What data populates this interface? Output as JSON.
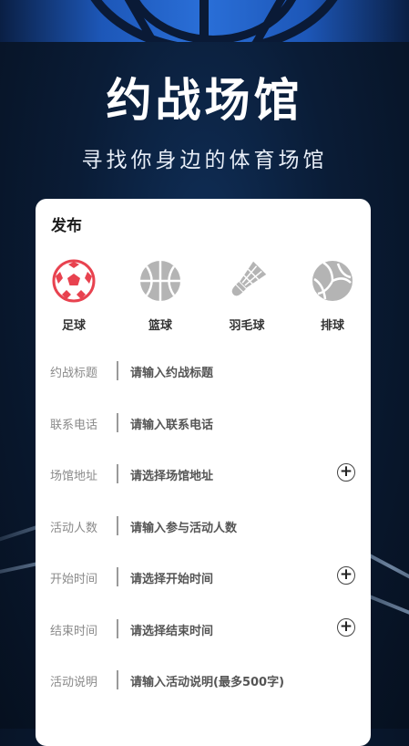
{
  "header": {
    "title": "约战场馆",
    "subtitle": "寻找你身边的体育场馆"
  },
  "card": {
    "title": "发布",
    "sports": [
      {
        "label": "足球",
        "icon": "soccer-ball-icon",
        "selected": true
      },
      {
        "label": "篮球",
        "icon": "basketball-icon",
        "selected": false
      },
      {
        "label": "羽毛球",
        "icon": "shuttlecock-icon",
        "selected": false
      },
      {
        "label": "排球",
        "icon": "volleyball-icon",
        "selected": false
      }
    ],
    "fields": [
      {
        "label": "约战标题",
        "placeholder": "请输入约战标题"
      },
      {
        "label": "联系电话",
        "placeholder": "请输入联系电话"
      },
      {
        "label": "场馆地址",
        "placeholder": "请选择场馆地址",
        "action": "+"
      },
      {
        "label": "活动人数",
        "placeholder": "请输入参与活动人数"
      },
      {
        "label": "开始时间",
        "placeholder": "请选择开始时间",
        "action": "+"
      },
      {
        "label": "结束时间",
        "placeholder": "请选择结束时间",
        "action": "+"
      },
      {
        "label": "活动说明",
        "placeholder": "请输入活动说明(最多500字)"
      }
    ]
  },
  "colors": {
    "selected": "#e8424f",
    "unselected": "#b4b4b4",
    "background": "#0a1c36"
  }
}
